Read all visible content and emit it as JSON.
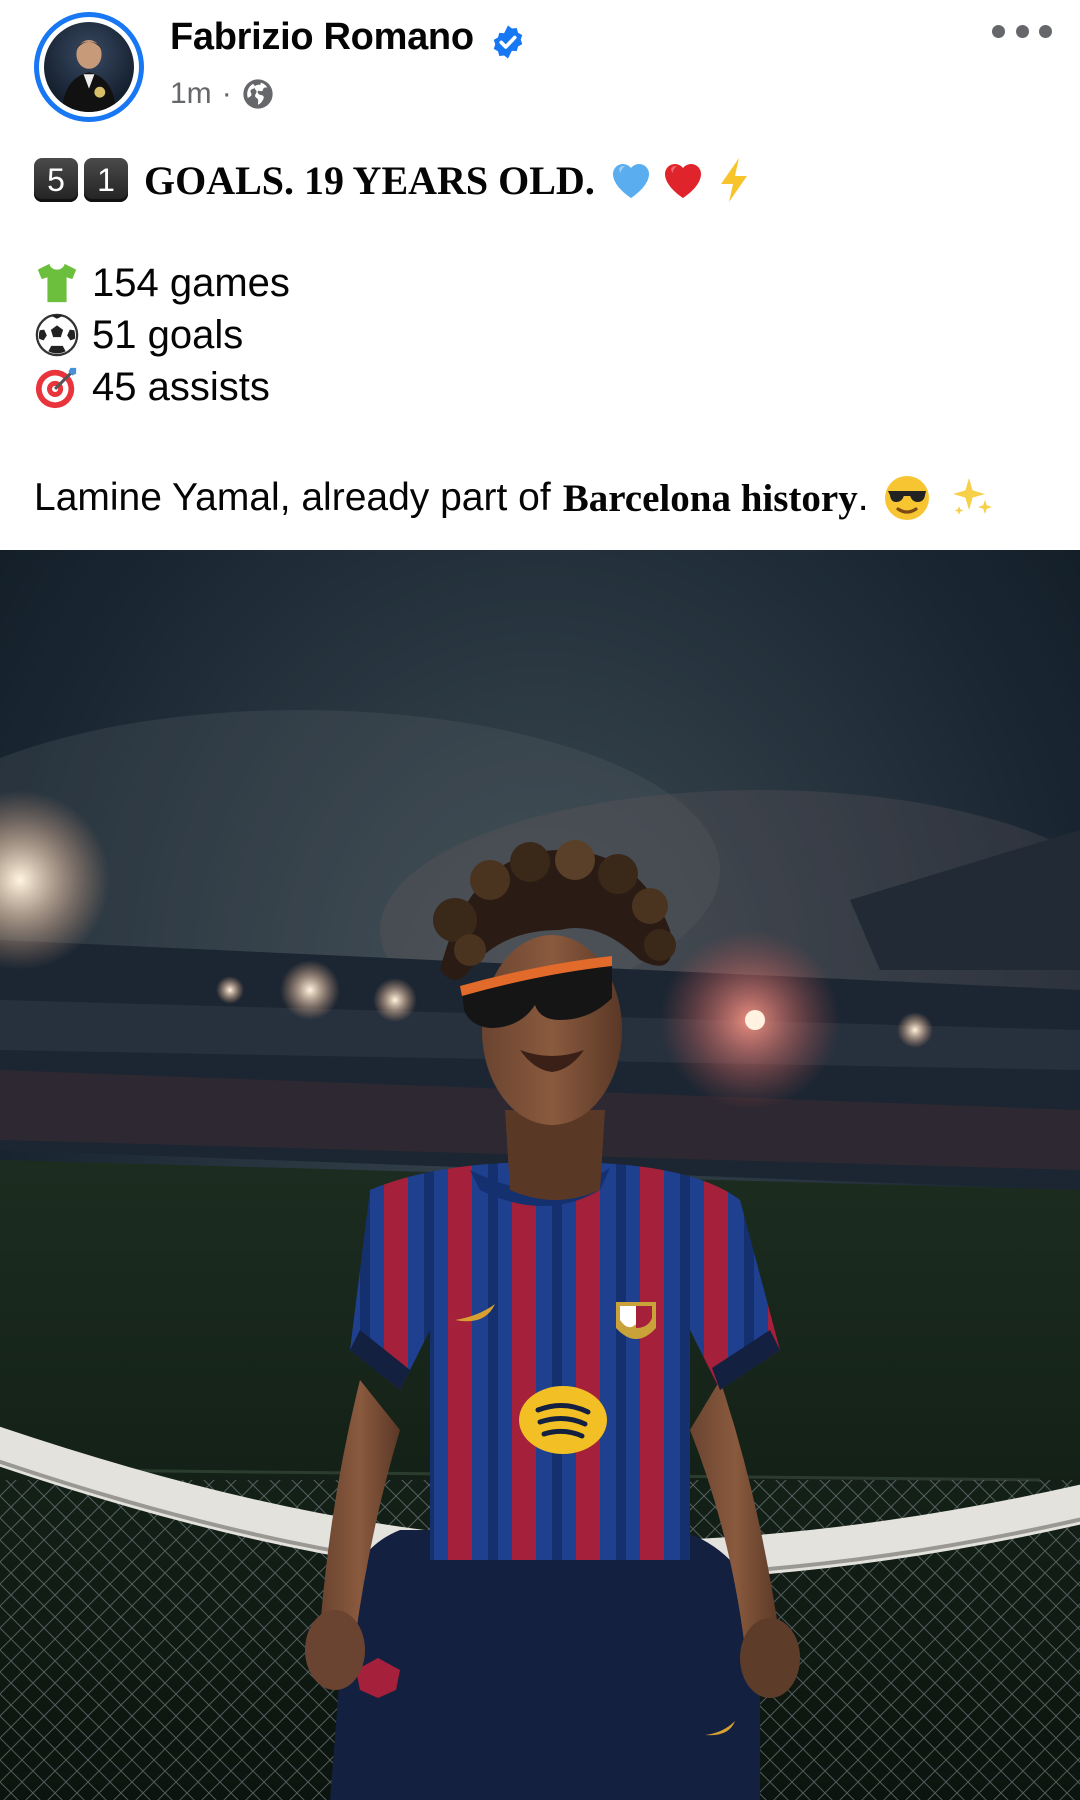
{
  "post": {
    "author": "Fabrizio Romano",
    "timestamp": "1m",
    "separator": "·",
    "privacy_icon": "globe-icon",
    "verified_icon": "verified-badge-icon",
    "more_icon": "more-options-icon",
    "headline": {
      "keycaps": [
        "5",
        "1"
      ],
      "text": "GOALS. 19 YEARS OLD.",
      "emojis": [
        "blue-heart",
        "red-heart",
        "lightning"
      ]
    },
    "stats": [
      {
        "icon": "tshirt-emoji",
        "text": "154 games"
      },
      {
        "icon": "soccer-ball-emoji",
        "text": "51 goals"
      },
      {
        "icon": "target-emoji",
        "text": "45 assists"
      }
    ],
    "closing": {
      "text": "Lamine Yamal, already part of",
      "bold_text": "Barcelona history",
      "end": ".",
      "emojis": [
        "sunglasses-face",
        "sparkles"
      ]
    },
    "image_alt": "Lamine Yamal in Barcelona kit sitting on goal frame in stadium at night"
  },
  "colors": {
    "accent": "#1877f2",
    "muted": "#65676b",
    "text": "#050505"
  }
}
